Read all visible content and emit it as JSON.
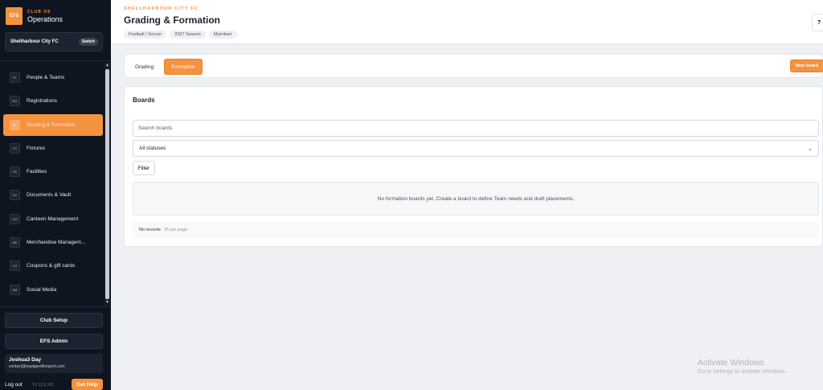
{
  "brand": {
    "logo": "EFS",
    "eyebrow": "CLUB OS",
    "title": "Operations"
  },
  "club": {
    "name": "Shellharbour City FC",
    "switch_label": "Switch"
  },
  "nav": [
    {
      "code": "PT",
      "label": "People & Teams",
      "icon": "people-icon"
    },
    {
      "code": "RG",
      "label": "Registrations",
      "icon": "registrations-icon"
    },
    {
      "code": "GF",
      "label": "Grading & Formation",
      "icon": "grading-icon",
      "active": true
    },
    {
      "code": "FX",
      "label": "Fixtures",
      "icon": "fixtures-icon"
    },
    {
      "code": "FA",
      "label": "Facilities",
      "icon": "facilities-icon"
    },
    {
      "code": "DV",
      "label": "Documents & Vault",
      "icon": "documents-icon"
    },
    {
      "code": "CM",
      "label": "Canteen Management",
      "icon": "canteen-icon"
    },
    {
      "code": "ME",
      "label": "Merchandise Managem...",
      "icon": "merchandise-icon"
    },
    {
      "code": "CG",
      "label": "Coupons & gift cards",
      "icon": "coupons-icon"
    },
    {
      "code": "SM",
      "label": "Social Media",
      "icon": "social-icon"
    }
  ],
  "sidebar_bottom": {
    "club_setup": "Club Setup",
    "efs_admin": "EFS Admin",
    "user_name": "Joshua3 Day",
    "user_email": "contact@equippedforsport.com",
    "logout": "Log out",
    "version": "V1.12.0.181",
    "get_help": "Get Help"
  },
  "header": {
    "eyebrow": "SHELLHARBOUR CITY FC",
    "title": "Grading & Formation",
    "chips": [
      "Football / Soccer",
      "2027 Season",
      "Myimbarr"
    ],
    "help": "?"
  },
  "tabs": {
    "grading": "Grading",
    "formation": "Formation",
    "new_board": "New board"
  },
  "boards": {
    "title": "Boards",
    "search_placeholder": "Search boards",
    "status_value": "All statuses",
    "filter": "Filter",
    "empty_message": "No formation boards yet. Create a board to define Team needs and draft placements.",
    "no_records": "No records",
    "per_page": "25 per page"
  },
  "watermark": {
    "title": "Activate Windows",
    "subtitle": "Go to Settings to activate Windows."
  },
  "colors": {
    "accent": "#f5923e",
    "sidebar_bg": "#0e1420",
    "page_bg": "#eef0f3"
  }
}
